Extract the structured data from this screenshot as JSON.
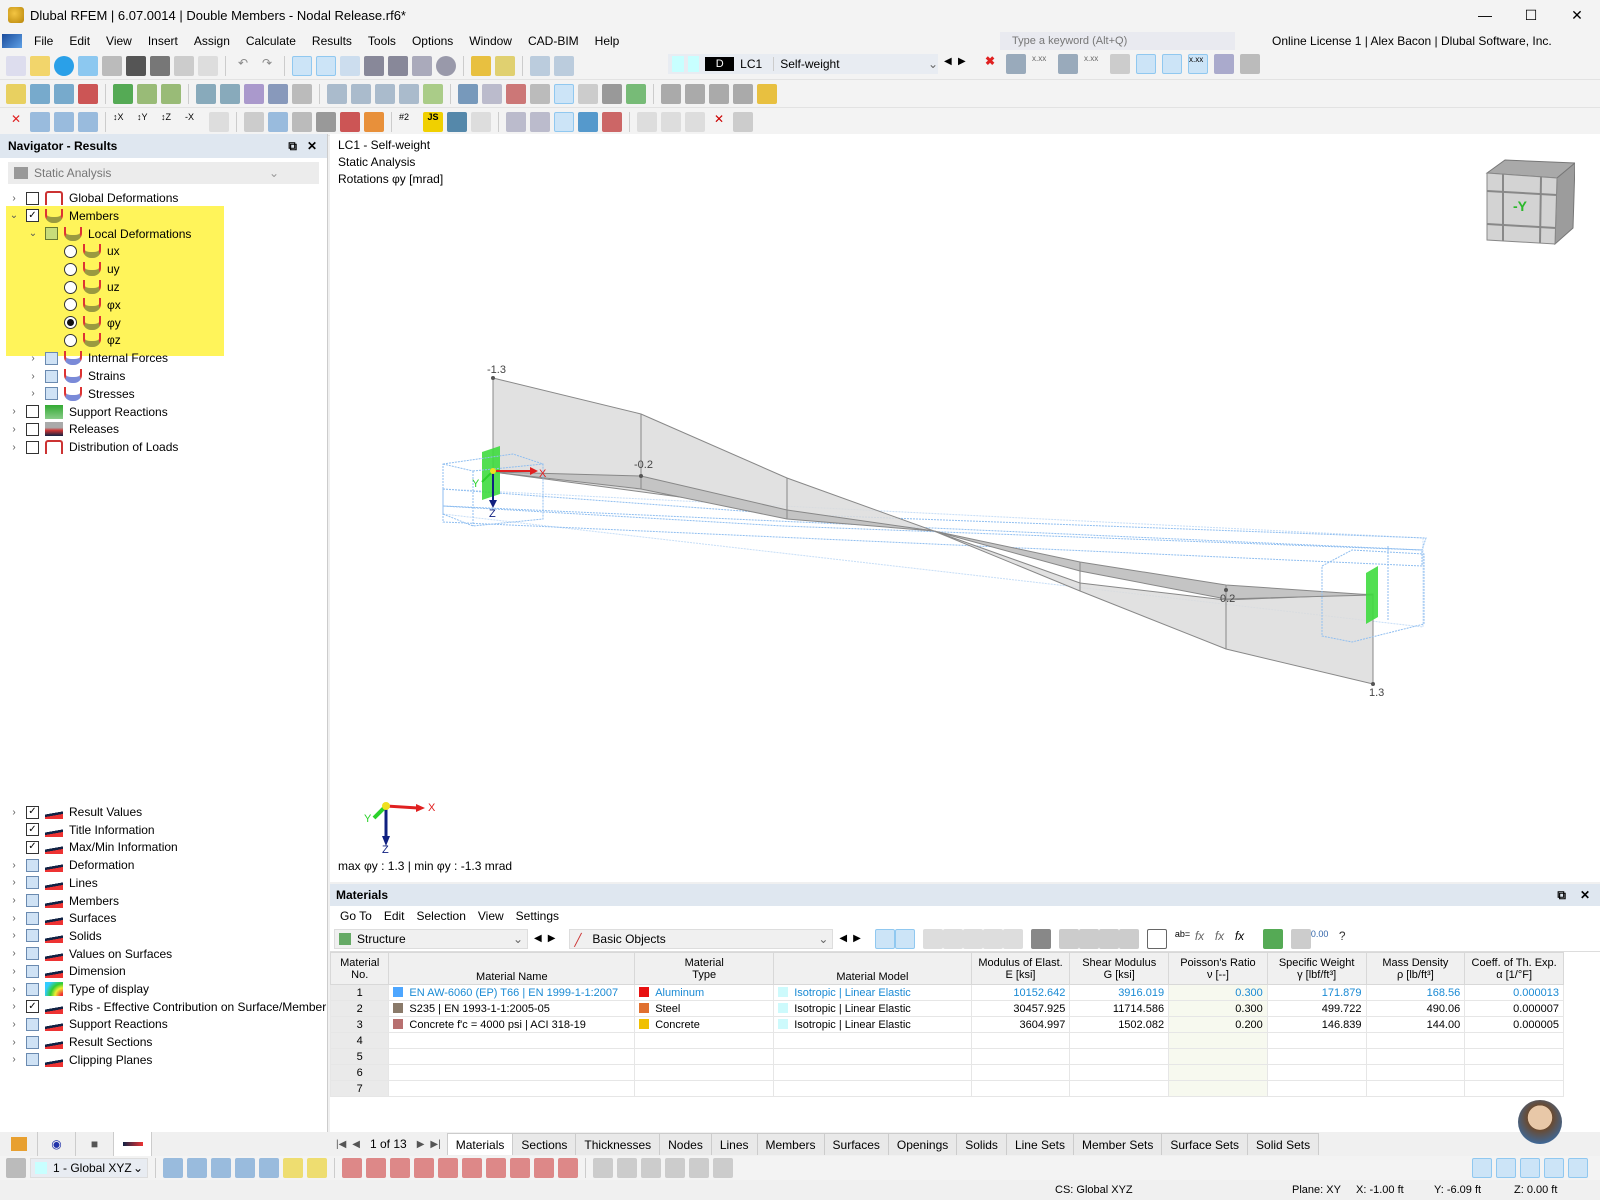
{
  "window": {
    "title": "Dlubal RFEM | 6.07.0014 | Double Members - Nodal Release.rf6*",
    "minimize": "—",
    "maximize": "☐",
    "close": "✕"
  },
  "menu": [
    "File",
    "Edit",
    "View",
    "Insert",
    "Assign",
    "Calculate",
    "Results",
    "Tools",
    "Options",
    "Window",
    "CAD-BIM",
    "Help"
  ],
  "search": {
    "placeholder": "Type a keyword (Alt+Q)"
  },
  "license": "Online License 1 | Alex Bacon | Dlubal Software, Inc.",
  "loadcase": {
    "type": "D",
    "id": "LC1",
    "name": "Self-weight"
  },
  "navigator": {
    "title": "Navigator - Results",
    "combo": "Static Analysis",
    "tree": [
      {
        "label": "Global Deformations",
        "exp": ">",
        "check": "none"
      },
      {
        "label": "Members",
        "exp": "v",
        "check": "checked"
      },
      {
        "label": "Local Deformations",
        "exp": "v",
        "check": "partial"
      },
      {
        "label": "ux",
        "radio": false
      },
      {
        "label": "uy",
        "radio": false
      },
      {
        "label": "uz",
        "radio": false
      },
      {
        "label": "φx",
        "radio": false
      },
      {
        "label": "φy",
        "radio": true
      },
      {
        "label": "φz",
        "radio": false
      },
      {
        "label": "Internal Forces",
        "exp": ">",
        "check": "blue"
      },
      {
        "label": "Strains",
        "exp": ">",
        "check": "blue"
      },
      {
        "label": "Stresses",
        "exp": ">",
        "check": "blue"
      },
      {
        "label": "Support Reactions",
        "exp": ">",
        "check": "none"
      },
      {
        "label": "Releases",
        "exp": ">",
        "check": "none"
      },
      {
        "label": "Distribution of Loads",
        "exp": ">",
        "check": "none"
      }
    ],
    "display": [
      {
        "label": "Result Values",
        "exp": ">",
        "check": "checked"
      },
      {
        "label": "Title Information",
        "exp": "",
        "check": "checked"
      },
      {
        "label": "Max/Min Information",
        "exp": "",
        "check": "checked"
      },
      {
        "label": "Deformation",
        "exp": ">",
        "check": "blue"
      },
      {
        "label": "Lines",
        "exp": ">",
        "check": "blue"
      },
      {
        "label": "Members",
        "exp": ">",
        "check": "blue"
      },
      {
        "label": "Surfaces",
        "exp": ">",
        "check": "blue"
      },
      {
        "label": "Solids",
        "exp": ">",
        "check": "blue"
      },
      {
        "label": "Values on Surfaces",
        "exp": ">",
        "check": "blue"
      },
      {
        "label": "Dimension",
        "exp": ">",
        "check": "blue"
      },
      {
        "label": "Type of display",
        "exp": ">",
        "check": "blue"
      },
      {
        "label": "Ribs - Effective Contribution on Surface/Member",
        "exp": ">",
        "check": "checked"
      },
      {
        "label": "Support Reactions",
        "exp": ">",
        "check": "blue"
      },
      {
        "label": "Result Sections",
        "exp": ">",
        "check": "blue"
      },
      {
        "label": "Clipping Planes",
        "exp": ">",
        "check": "blue"
      }
    ]
  },
  "viewport": {
    "info": [
      "LC1 - Self-weight",
      "Static Analysis",
      "Rotations φy [mrad]"
    ],
    "labels": {
      "top_left": "-1.3",
      "mid_left": "-0.2",
      "mid_right": "0.2",
      "bottom_right": "1.3"
    },
    "axes": {
      "x": "X",
      "y": "Y",
      "z": "Z"
    },
    "cube_face": "-Y",
    "maxmin": "max φy : 1.3 | min φy : -1.3 mrad"
  },
  "materials": {
    "title": "Materials",
    "menu": [
      "Go To",
      "Edit",
      "Selection",
      "View",
      "Settings"
    ],
    "combo1": "Structure",
    "combo2": "Basic Objects",
    "headers": [
      [
        "Material",
        "No."
      ],
      [
        "",
        "Material Name"
      ],
      [
        "Material",
        "Type"
      ],
      [
        "",
        "Material Model"
      ],
      [
        "Modulus of Elast.",
        "E [ksi]"
      ],
      [
        "Shear Modulus",
        "G [ksi]"
      ],
      [
        "Poisson's Ratio",
        "ν [--]"
      ],
      [
        "Specific Weight",
        "γ [lbf/ft³]"
      ],
      [
        "Mass Density",
        "ρ [lb/ft³]"
      ],
      [
        "Coeff. of Th. Exp.",
        "α [1/°F]"
      ]
    ],
    "rows": [
      {
        "no": "1",
        "name": "EN AW-6060 (EP) T66 | EN 1999-1-1:2007",
        "name_color": "#4da6ff",
        "type": "Aluminum",
        "type_color": "#e81010",
        "model": "Isotropic | Linear Elastic",
        "E": "10152.642",
        "G": "3916.019",
        "nu": "0.300",
        "gamma": "171.879",
        "rho": "168.56",
        "alpha": "0.000013",
        "highlight": true
      },
      {
        "no": "2",
        "name": "S235 | EN 1993-1-1:2005-05",
        "name_color": "#8a7a6a",
        "type": "Steel",
        "type_color": "#e07030",
        "model": "Isotropic | Linear Elastic",
        "E": "30457.925",
        "G": "11714.586",
        "nu": "0.300",
        "gamma": "499.722",
        "rho": "490.06",
        "alpha": "0.000007",
        "highlight": false
      },
      {
        "no": "3",
        "name": "Concrete f'c = 4000 psi | ACI 318-19",
        "name_color": "#b87070",
        "type": "Concrete",
        "type_color": "#f0c000",
        "model": "Isotropic | Linear Elastic",
        "E": "3604.997",
        "G": "1502.082",
        "nu": "0.200",
        "gamma": "146.839",
        "rho": "144.00",
        "alpha": "0.000005",
        "highlight": false
      },
      {
        "no": "4"
      },
      {
        "no": "5"
      },
      {
        "no": "6"
      },
      {
        "no": "7"
      }
    ],
    "pager": "1 of 13",
    "tabs": [
      "Materials",
      "Sections",
      "Thicknesses",
      "Nodes",
      "Lines",
      "Members",
      "Surfaces",
      "Openings",
      "Solids",
      "Line Sets",
      "Member Sets",
      "Surface Sets",
      "Solid Sets"
    ],
    "active_tab": "Materials"
  },
  "bottom": {
    "cs_combo": "1 - Global XYZ"
  },
  "status": {
    "cs": "CS: Global XYZ",
    "plane": "Plane: XY",
    "x": "X: -1.00 ft",
    "y": "Y: -6.09 ft",
    "z": "Z: 0.00 ft"
  }
}
